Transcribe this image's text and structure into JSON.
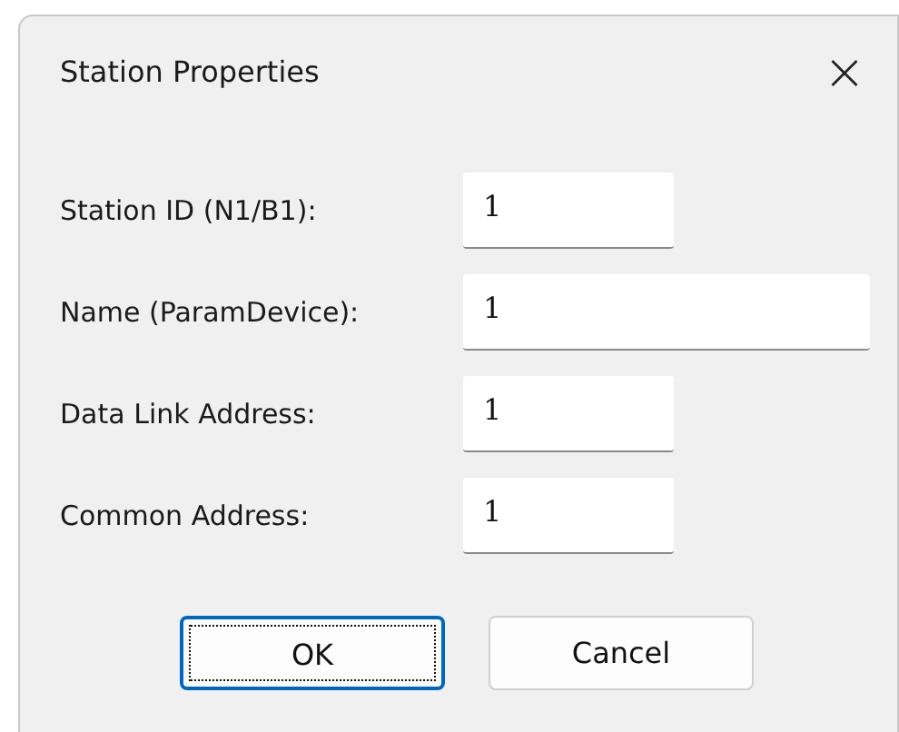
{
  "window": {
    "title": "Station Properties",
    "close": "×"
  },
  "fields": [
    {
      "label": "Station ID (N1/B1):",
      "value": "1",
      "kind": "short"
    },
    {
      "label": "Name (ParamDevice):",
      "value": "1",
      "kind": "wide"
    },
    {
      "label": "Data Link Address:",
      "value": "1",
      "kind": "short"
    },
    {
      "label": "Common Address:",
      "value": "1",
      "kind": "short"
    }
  ],
  "buttons": [
    {
      "label": "OK",
      "focused": true
    },
    {
      "label": "Cancel",
      "focused": false
    }
  ]
}
